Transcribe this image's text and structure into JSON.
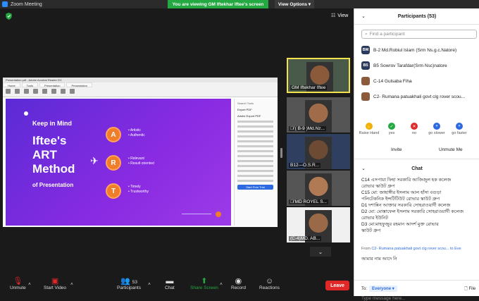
{
  "window": {
    "title": "Zoom Meeting"
  },
  "banner": {
    "viewing": "You are viewing GM Iftekhar Iftee's screen",
    "view_options": "View Options"
  },
  "toolbar_top": {
    "view_label": "View"
  },
  "shared": {
    "slide": {
      "keep": "Keep in Mind",
      "line1": "Iftee's",
      "line2": "ART",
      "line3": "Method",
      "line4": "of Presentation",
      "a_letter": "A",
      "a_b1": "• Artistic",
      "a_b2": "• Authentic",
      "r_letter": "R",
      "r_b1": "• Relevant",
      "r_b2": "• Result oriented",
      "t_letter": "T",
      "t_b1": "• Timely",
      "t_b2": "• Trustworthy"
    },
    "pdf_panel": {
      "search": "Search Tools",
      "export_pdf": "Export PDF",
      "adobe_export": "Adobe Export PDF",
      "start": "Start Free Trial"
    }
  },
  "gallery": [
    {
      "name": "GM Iftekhar Iftee",
      "muted": false,
      "speaking": true,
      "skin": "#8a5a3a"
    },
    {
      "name": "( B-9 )Md.Nz...",
      "muted": true,
      "speaking": false,
      "skin": "#a06b48"
    },
    {
      "name": "B12---O.S.R...",
      "muted": false,
      "speaking": false,
      "skin": "#6d4a33"
    },
    {
      "name": "MD ROYEL S...",
      "muted": true,
      "speaking": false,
      "skin": "#b07a55"
    },
    {
      "name": "(C-4)MD. AB...",
      "muted": false,
      "speaking": false,
      "skin": "#9a6a48"
    }
  ],
  "toolbar": {
    "unmute": "Unmute",
    "start_video": "Start Video",
    "participants": "Participants",
    "participants_count": "53",
    "chat": "Chat",
    "share_screen": "Share Screen",
    "record": "Record",
    "reactions": "Reactions",
    "leave": "Leave"
  },
  "participants_panel": {
    "title": "Participants (53)",
    "find_placeholder": "Find a participant",
    "rows": [
      {
        "initials": "BM",
        "name": "B-2 Md.Robiul Islam (Srm Ns.g.c.Natore)"
      },
      {
        "initials": "B5",
        "name": "B5 Sowrov Tarafdar(Srm Nsc)natore"
      },
      {
        "initials": "",
        "name": "C-14 Gulsaba Fiha"
      },
      {
        "initials": "",
        "name": "C2- Rumana patuakhali govt clg rover scou..."
      }
    ],
    "reactions": [
      {
        "label": "Raise Hand",
        "color": "#f0b000",
        "icon": "✋"
      },
      {
        "label": "yes",
        "color": "#23a842",
        "icon": "✓"
      },
      {
        "label": "no",
        "color": "#e02828",
        "icon": "✕"
      },
      {
        "label": "go slower",
        "color": "#2d6ae0",
        "icon": "«"
      },
      {
        "label": "go faster",
        "color": "#2d6ae0",
        "icon": "»"
      }
    ],
    "invite": "Invite",
    "unmute_me": "Unmute Me"
  },
  "chat_panel": {
    "title": "Chat",
    "lines": [
      "C14    এসপায়া ফিহা    সরকারি আজিজুল হক কলেজ",
      "রোভার স্কাউট গ্রুপ",
      "C15    মো: জাহাঙ্গীর ইসলাম আল হাঁসা    বগুড়া",
      "পলিটেকনিক ইন্সটিটিউট রোভার স্কাউট গ্রুপ",
      "D1      দশান্নিন আক্তার    সরকারি সোহরাওয়ার্দী কলেজ",
      "D2      মো: মোস্তাফেল ইসলাম    সরকারি সোহরাওয়ার্দী কলেজ",
      "রোভার ইউনিট",
      "D3      মো:মাহফুজুর রহমান        আদর্শ মুক্ত রোভার",
      "স্কাউট গ্রুপ"
    ],
    "from_prefix": "From",
    "from_name": "C2- Rumana patuakhali govt clg rover scou...",
    "from_to": "to Eve",
    "last_msg": "আমার নাম আদে নি",
    "to_label": "To:",
    "to_value": "Everyone",
    "file": "File",
    "input_placeholder": "Type message here..."
  }
}
